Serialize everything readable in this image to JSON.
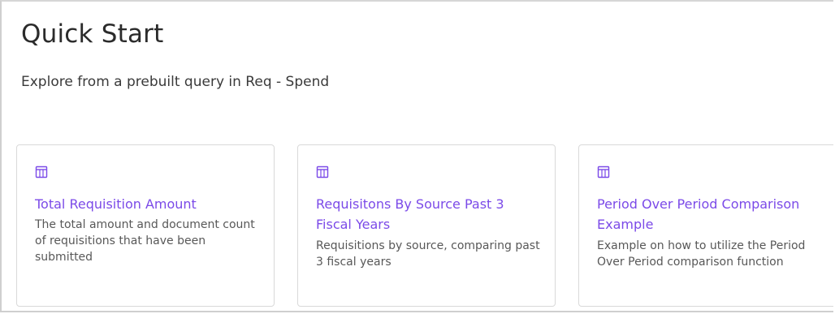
{
  "header": {
    "title": "Quick Start",
    "subtitle": "Explore from a prebuilt query in Req - Spend"
  },
  "colors": {
    "accent": "#7b4ae8",
    "text": "#2b2b2b",
    "muted": "#585858",
    "border": "#d9d9d9"
  },
  "cards": [
    {
      "icon": "table-icon",
      "title": "Total Requisition Amount",
      "description": "The total amount and document count of requisitions that have been submitted"
    },
    {
      "icon": "table-icon",
      "title": "Requisitons By Source Past 3 Fiscal Years",
      "description": "Requisitions by source, comparing past 3 fiscal years"
    },
    {
      "icon": "table-icon",
      "title": "Period Over Period Comparison Example",
      "description": "Example on how to utilize the Period Over Period comparison function"
    }
  ]
}
